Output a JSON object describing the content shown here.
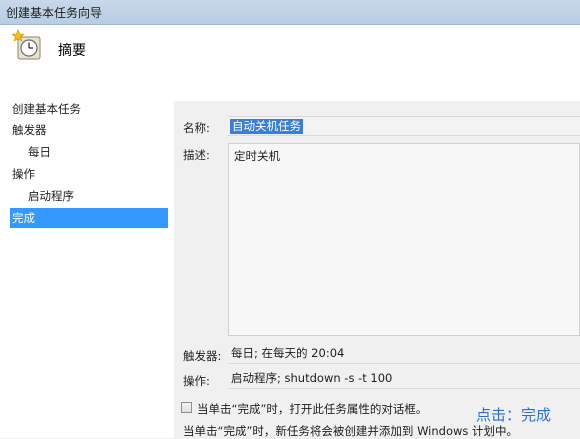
{
  "window": {
    "title": "创建基本任务向导"
  },
  "header": {
    "title": "摘要",
    "icon": "clock-star-icon"
  },
  "nav": {
    "items": [
      {
        "label": "创建基本任务"
      },
      {
        "label": "触发器"
      },
      {
        "label": "每日"
      },
      {
        "label": "操作"
      },
      {
        "label": "启动程序"
      },
      {
        "label": "完成"
      }
    ]
  },
  "summary": {
    "name_label": "名称:",
    "name_value": "自动关机任务",
    "desc_label": "描述:",
    "desc_value": "定时关机",
    "trigger_label": "触发器:",
    "trigger_value": "每日; 在每天的 20:04",
    "action_label": "操作:",
    "action_value": "启动程序; shutdown -s -t 100"
  },
  "options": {
    "open_props_label": "当单击“完成”时，打开此任务属性的对话框。",
    "open_props_checked": false,
    "note": "当单击“完成”时，新任务将会被创建并添加到 Windows 计划中。"
  },
  "annotation": {
    "text": "点击：完成",
    "color": "#2f6fd0"
  },
  "colors": {
    "selected_bg": "#3399ff",
    "text_selection": "#3a7fd6"
  }
}
